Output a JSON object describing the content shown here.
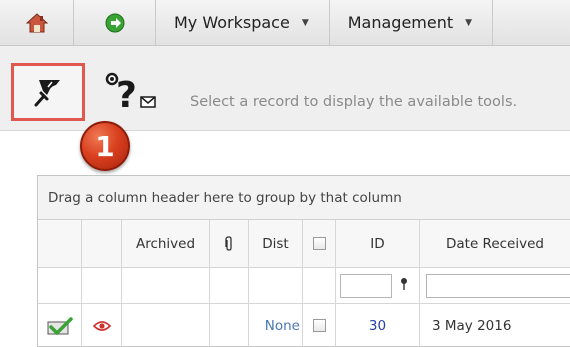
{
  "nav": {
    "home_icon": "home-icon",
    "go_icon": "green-arrow-icon",
    "menus": [
      {
        "label": "My Workspace",
        "caret": "▼"
      },
      {
        "label": "Management",
        "caret": "▼"
      }
    ]
  },
  "toolbar": {
    "tool_icon": "pin-tool-icon",
    "help_icon": "help-question-icon",
    "message": "Select a record to display the available tools."
  },
  "annotation": {
    "step": "1",
    "color": "#d9401f"
  },
  "grid": {
    "group_hint": "Drag a column header here to group by that column",
    "columns": [
      "",
      "",
      "Archived",
      "",
      "Dist",
      "",
      "ID",
      "Date Received"
    ],
    "filter_icon": "filter-pin-icon",
    "rows": [
      {
        "status_icon": "approved-check-icon",
        "view_icon": "eye-icon",
        "archived": "",
        "attachment": "",
        "dist": "None",
        "checked": false,
        "id": "30",
        "date_received": "3 May 2016"
      }
    ]
  },
  "colors": {
    "highlight_border": "#e0584f",
    "link": "#4a78b5",
    "id": "#2a3fa6"
  }
}
